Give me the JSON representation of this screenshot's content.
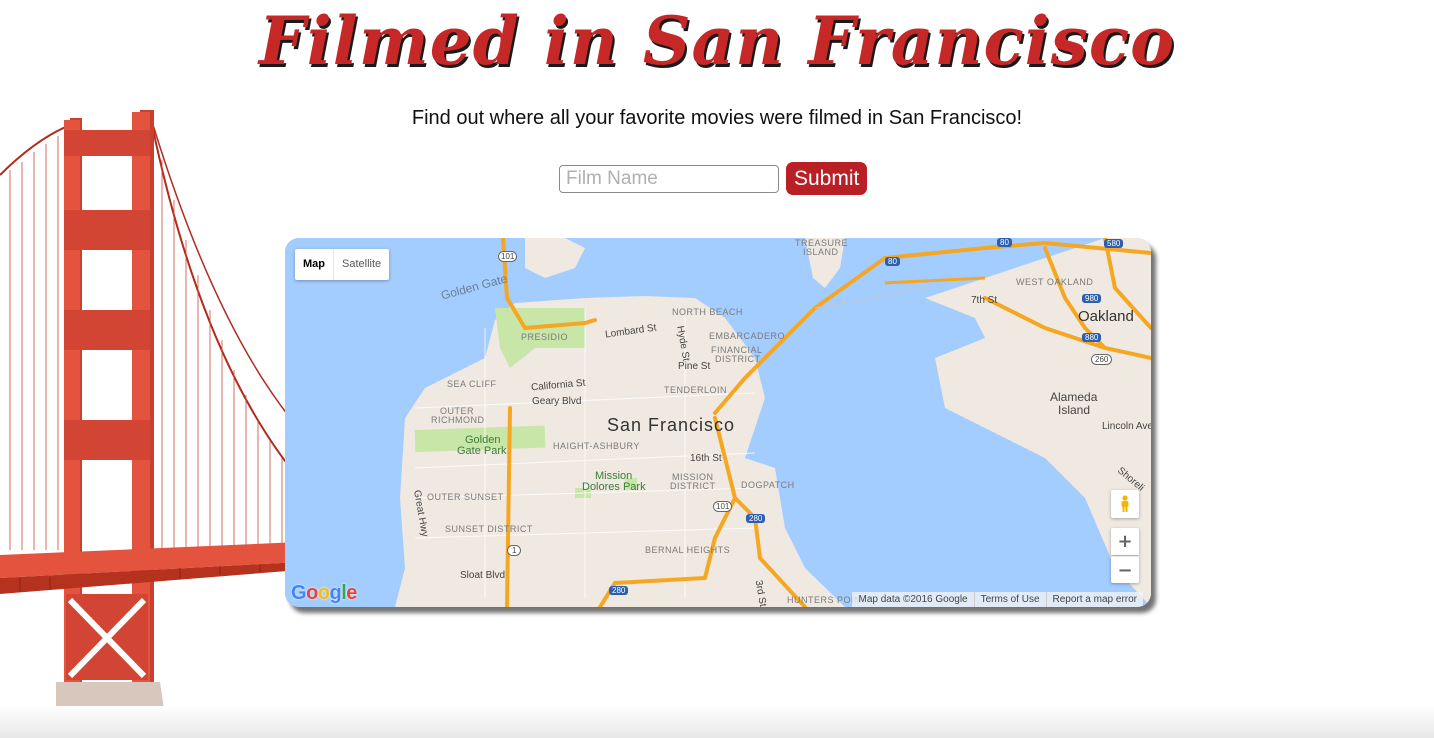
{
  "header": {
    "title": "Filmed in San Francisco",
    "subtitle": "Find out where all your favorite movies were filmed in San Francisco!"
  },
  "search": {
    "placeholder": "Film Name",
    "value": "",
    "submit_label": "Submit"
  },
  "map": {
    "type_controls": [
      "Map",
      "Satellite"
    ],
    "active_type": "Map",
    "zoom_in": "+",
    "zoom_out": "−",
    "logo": "Google",
    "attribution": {
      "data": "Map data ©2016 Google",
      "terms": "Terms of Use",
      "report": "Report a map error"
    },
    "labels": {
      "city_sf": "San Francisco",
      "city_oakland": "Oakland",
      "alameda": "Alameda",
      "island": "Island",
      "golden_gate": "Golden Gate",
      "treasure": "TREASURE",
      "treasure_island": "ISLAND",
      "north_beach": "NORTH BEACH",
      "embarcadero": "EMBARCADERO",
      "financial": "FINANCIAL",
      "financial_district": "DISTRICT",
      "presidio": "PRESIDIO",
      "tenderloin": "TENDERLOIN",
      "sea_cliff": "SEA CLIFF",
      "outer": "OUTER",
      "richmond": "RICHMOND",
      "haight_ashbury": "HAIGHT-ASHBURY",
      "outer_sunset": "OUTER SUNSET",
      "sunset_district": "SUNSET DISTRICT",
      "mission": "MISSION",
      "mission_district": "DISTRICT",
      "dogpatch": "DOGPATCH",
      "bernal_heights": "BERNAL HEIGHTS",
      "hunters_point": "HUNTERS POINT",
      "west_oakland": "WEST OAKLAND",
      "golden_gate_park_1": "Golden",
      "golden_gate_park_2": "Gate Park",
      "mission_dolores_1": "Mission",
      "mission_dolores_2": "Dolores Park",
      "lombard": "Lombard St",
      "hyde": "Hyde St",
      "pine": "Pine St",
      "california": "California St",
      "geary": "Geary Blvd",
      "sixteenth": "16th St",
      "great_hwy": "Great Hwy",
      "sloat": "Sloat Blvd",
      "third": "3rd St",
      "seventh": "7th St",
      "lincoln": "Lincoln Ave",
      "shoreline": "Shoreli"
    },
    "shields": {
      "us101_top": "101",
      "i80": "80",
      "i580": "580",
      "i980": "980",
      "i880": "880",
      "r260": "260",
      "us101_bottom": "101",
      "i280_mid": "280",
      "r1": "1",
      "i280_bottom": "280",
      "top_edge": "80"
    }
  },
  "colors": {
    "title": "#c62828",
    "submit_bg": "#b82025",
    "water": "#a3ccff",
    "land": "#efe9e1",
    "park": "#c8e6a8",
    "freeway": "#f5a623",
    "bridge_red": "#d6402e"
  }
}
